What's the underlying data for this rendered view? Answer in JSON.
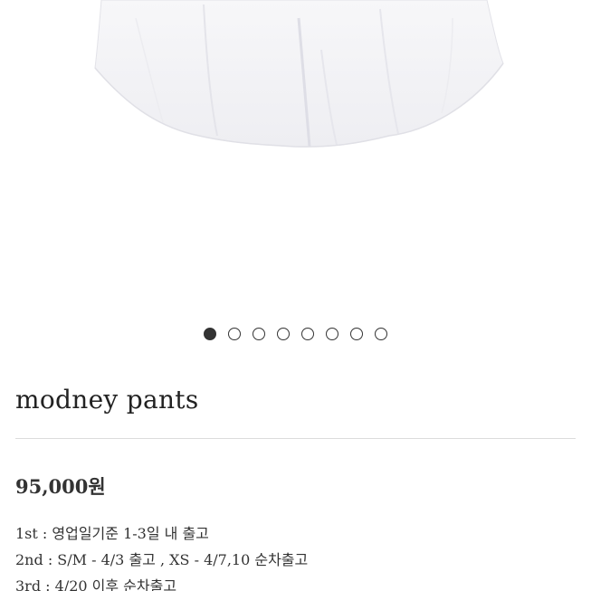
{
  "product": {
    "title": "modney pants",
    "price": "95,000원",
    "image_alt": "white pleated skirt"
  },
  "carousel": {
    "total": 8,
    "active_index": 0,
    "active_color": "#333333"
  },
  "shipping_info": [
    "1st : 영업일기준 1-3일 내 출고",
    "2nd : S/M - 4/3 출고 , XS - 4/7,10 순차출고",
    "3rd : 4/20 이후 순차출고"
  ]
}
